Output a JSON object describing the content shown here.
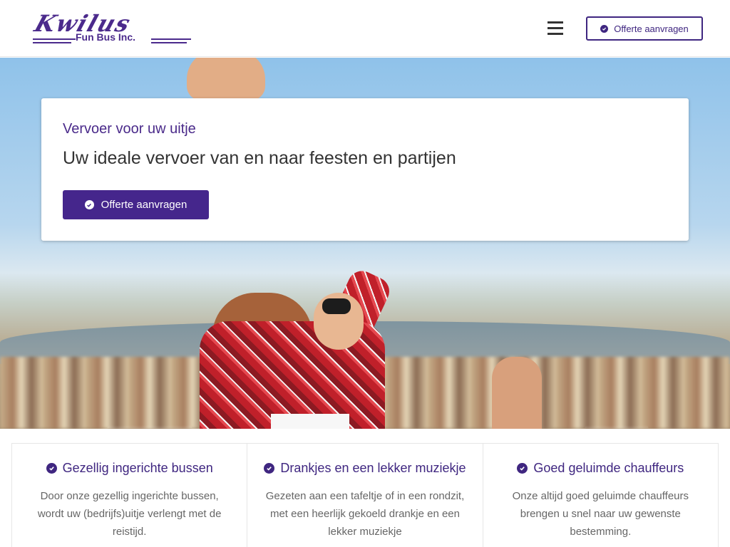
{
  "header": {
    "logo_script": "Kwilus",
    "logo_sub": "Fun Bus Inc.",
    "cta_label": "Offerte aanvragen"
  },
  "hero": {
    "subtitle": "Vervoer voor uw uitje",
    "title": "Uw ideale vervoer van en naar feesten en partijen",
    "cta_label": "Offerte aanvragen"
  },
  "features": [
    {
      "icon": "check-circle-icon",
      "title": "Gezellig ingerichte bussen",
      "text": "Door onze gezellig ingerichte bussen, wordt uw (bedrijfs)uitje verlengt met de reistijd."
    },
    {
      "icon": "check-circle-icon",
      "title": "Drankjes en een lekker muziekje",
      "text": "Gezeten aan een tafeltje of in een rondzit, met een heerlijk gekoeld drankje en een lekker muziekje"
    },
    {
      "icon": "check-circle-icon",
      "title": "Goed geluimde chauffeurs",
      "text": "Onze altijd goed geluimde chauffeurs brengen u snel naar uw gewenste bestemming."
    }
  ],
  "colors": {
    "brand": "#45268c",
    "text": "#333333",
    "muted": "#666666"
  }
}
